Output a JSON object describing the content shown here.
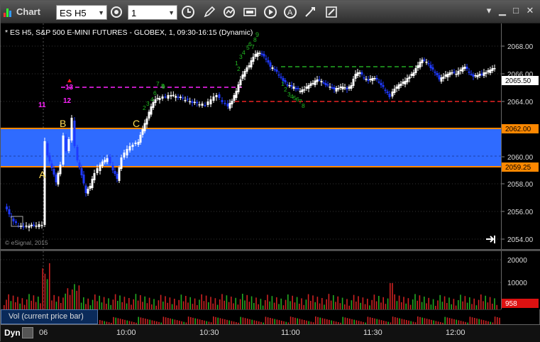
{
  "titlebar": {
    "app_title": "Chart",
    "symbol": "ES H5",
    "interval": "1"
  },
  "chart": {
    "header": "* ES H5, S&P 500 E-MINI FUTURES - GLOBEX, 1, 09:30-16:15 (Dynamic)",
    "copyright": "© eSignal, 2015",
    "price_labels": [
      "2068.00",
      "2066.00",
      "2064.00",
      "2062.00",
      "2060.00",
      "2058.00",
      "2056.00",
      "2054.00"
    ],
    "tag_labels": [
      {
        "text": "2065.50",
        "color": "#ffffff",
        "bg": "#ffffff"
      },
      {
        "text": "2062.00",
        "color": "#000000",
        "bg": "#ff8800"
      },
      {
        "text": "2059.25",
        "color": "#000000",
        "bg": "#ff8800"
      }
    ],
    "annotations": {
      "A": "A",
      "B": "B",
      "C": "C",
      "n11": "11",
      "n12": "12",
      "n13": "13",
      "n9": "9"
    },
    "colors": {
      "zone": "#2f6bff",
      "orange": "#ff8800",
      "magenta": "#ff22ff",
      "green_dash": "#22aa22",
      "red_dash": "#ee2222",
      "bull": "#ffffff",
      "bear": "#1f3aff",
      "count": "#22bb22"
    }
  },
  "volume": {
    "label": "Vol (current price bar)",
    "axis_labels": [
      "20000",
      "10000"
    ],
    "current_value": "958"
  },
  "xaxis": {
    "mode": "Dyn",
    "labels": [
      "06",
      "10:00",
      "10:30",
      "11:00",
      "11:30",
      "12:00"
    ]
  }
}
